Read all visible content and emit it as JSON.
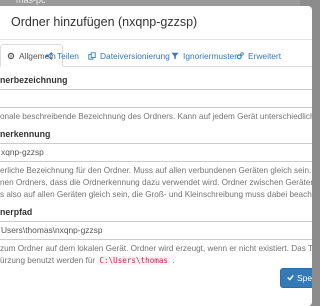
{
  "backdrop": {
    "text": "mas-pc"
  },
  "modal": {
    "title": "Ordner hinzufügen (nxqnp-gzzsp)",
    "tabs": [
      {
        "label": "Allgemein",
        "icon": "gear-icon",
        "active": true
      },
      {
        "label": "Teilen",
        "icon": "share-icon",
        "active": false
      },
      {
        "label": "Dateiversionierung",
        "icon": "copy-icon",
        "active": false
      },
      {
        "label": "Ignoriermuster",
        "icon": "filter-icon",
        "active": false
      },
      {
        "label": "Erweitert",
        "icon": "cogs-icon",
        "active": false
      }
    ],
    "fields": {
      "label_field": {
        "label": "nerbezeichnung",
        "value": "",
        "help": "onale beschreibende Bezeichnung des Ordners. Kann auf jedem Gerät unterschiedlich sein."
      },
      "id_field": {
        "label": "nerkennung",
        "value": "xqnp-gzzsp",
        "help_lines": [
          "erliche Bezeichnung für den Ordner. Muss auf allen verbundenen Geräten gleich sein. Beachte l",
          "nen Ordners, dass die Ordnerkennung dazu verwendet wird. Ordner zwischen Geräten zu ver",
          "s also auf allen Geräten gleich sein, die Groß- und Kleinschreibung muss dabei beachtet werden."
        ]
      },
      "path_field": {
        "label": "nerpfad",
        "value": "Users\\thomas\\nxqnp-gzzsp",
        "help_line1": "zum Ordner auf dem lokalen Gerät. Ordner wird erzeugt, wenn er nicht existiert. Das Tilden-Zeic",
        "help_line2_prefix": "ürzung benutzt werden für",
        "help_code": "C:\\Users\\thomas",
        "help_line2_suffix": "."
      }
    },
    "save_label": "Spe"
  },
  "colors": {
    "accent": "#337ab7",
    "code": "#c7254e"
  }
}
